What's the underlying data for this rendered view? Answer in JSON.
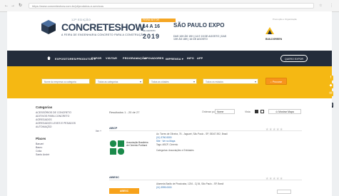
{
  "browser": {
    "url": "https://www.concreteshow.com.br/pt/produtos-e-servicos",
    "back": "←",
    "forward": "→",
    "reload": "↻",
    "star": "☆",
    "menu": "⋮"
  },
  "header": {
    "edition": "12ª EDIÇÃO",
    "brand": "CONCRETESHOW",
    "tagline": "A FEIRA DE ENGENHARIA CONCRETO PARA A CONSTRUÇÃO",
    "date_badge": "FEIRA SETOR",
    "days": "14 A 16",
    "month": "DE AGOSTO",
    "year": "2019",
    "venue": "SÃO PAULO EXPO",
    "venue_detail": "DAS 10H ÀS 19H | 14 E 15 DE AGOSTO | DAS 10H ÀS 18H | 16 DE AGOSTO",
    "sponsor_label": "Promoção e Organização",
    "sponsor_name": "BUILDGREEN"
  },
  "menu": {
    "items": [
      "EXPOSITORES/PRODUTOS ▾",
      "EXPOR",
      "VISITAR",
      "PROGRAMAÇÃO",
      "APOIADORES",
      "IMPRENSA ▾",
      "INFO",
      "APP"
    ],
    "cta": "QUERO EXPOR"
  },
  "filters": {
    "keyword": "Nome da empresa ou categoria",
    "category": "Todas as categorias",
    "city": "Todas as cidades",
    "state": "Todos os estados",
    "search": "Procurar"
  },
  "sidebar": {
    "categories_title": "Categorias",
    "categories": [
      "ACESSÓRIOS DE CONCRETO",
      "ADITIVOS PARA CONCRETO",
      "AGREGADOS",
      "AGREGADOS LEVES E PESADOS",
      "AUTOMAÇÃO"
    ],
    "more": "Ver +",
    "places_title": "Places",
    "places": [
      "Barueri",
      "Bauru",
      "Cotia",
      "Santo André"
    ]
  },
  "toolbar": {
    "results": "Resultados 1 - 20 de 27",
    "sort_label": "Ordenar por",
    "sort_value": "Nome",
    "view_label": "Vista",
    "map_button": "Mostrar Mapa"
  },
  "cards": [
    {
      "title": "ABCP",
      "address": "Av. Torres de Oliveira, 76 - Jaguaré, São Paulo - SP, 05347-902, Brasil",
      "phone": "(11) 3760-5300",
      "category": "Site · Ver no Mapa",
      "tags": "Tags: ABCP, Cimento",
      "logo_text": "Associação Brasileira de Cimento Portland",
      "extra": "Categorias: Associações e Entidades",
      "stars": "★★★★★"
    },
    {
      "title": "ABESC",
      "address": "Alameda Barão de Piracicaba, 1234 - Cj 54, São Paulo - SP, Brasil",
      "phone": "(11) 3999-0000",
      "logo_text": "ABESC",
      "stars": "★★★★★"
    }
  ],
  "side_icons": [
    "f",
    "◆",
    "✉",
    "▤"
  ],
  "colors": {
    "accent": "#f5b813",
    "navy": "#232c3b",
    "brand": "#2d3e55",
    "orange": "#f7941d"
  }
}
